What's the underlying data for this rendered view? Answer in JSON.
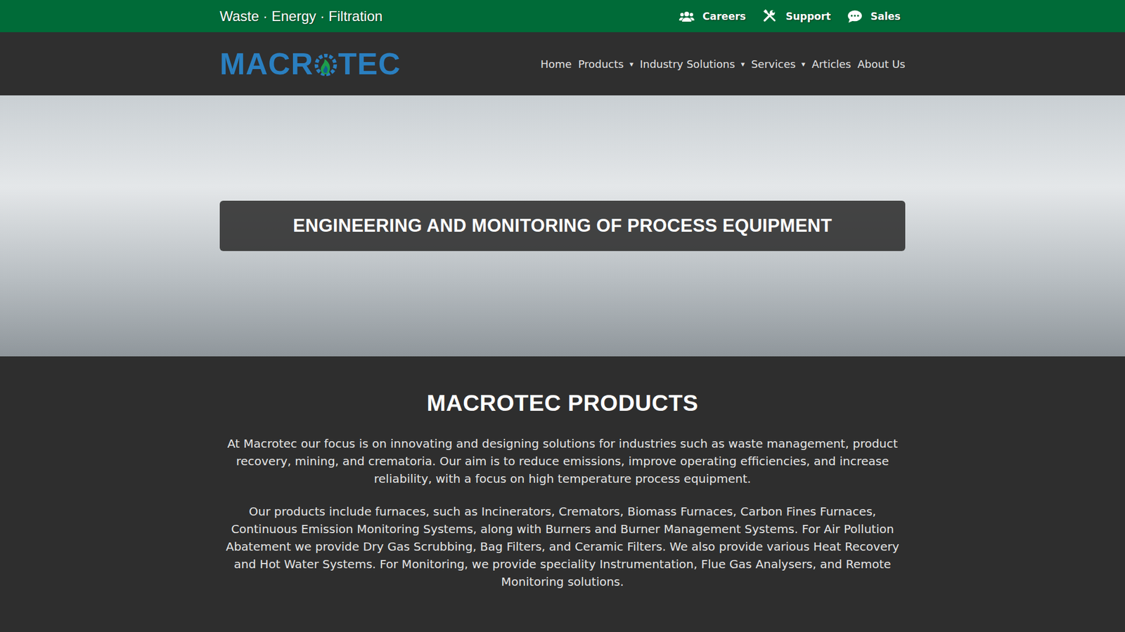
{
  "topbar": {
    "tagline": "Waste · Energy · Filtration",
    "links": [
      {
        "label": "Careers",
        "icon": "users"
      },
      {
        "label": "Support",
        "icon": "tools"
      },
      {
        "label": "Sales",
        "icon": "chat"
      }
    ]
  },
  "logo": {
    "before": "MACR",
    "after": "TEC"
  },
  "nav": [
    {
      "label": "Home",
      "dropdown": false
    },
    {
      "label": "Products",
      "dropdown": true
    },
    {
      "label": "Industry Solutions",
      "dropdown": true
    },
    {
      "label": "Services",
      "dropdown": true
    },
    {
      "label": "Articles",
      "dropdown": false
    },
    {
      "label": "About Us",
      "dropdown": false
    }
  ],
  "nav_caret": "▾",
  "hero": {
    "title": "ENGINEERING AND MONITORING OF PROCESS EQUIPMENT"
  },
  "section": {
    "heading": "MACROTEC PRODUCTS",
    "paragraphs": [
      "At Macrotec our focus is on innovating and designing solutions for industries such as waste management, product recovery, mining, and crematoria. Our aim is to reduce emissions, improve operating efficiencies, and increase reliability, with a focus on high temperature process equipment.",
      "Our products include furnaces, such as Incinerators, Cremators, Biomass Furnaces, Carbon Fines Furnaces, Continuous Emission Monitoring Systems, along with Burners and Burner Management Systems. For Air Pollution Abatement we provide Dry Gas Scrubbing, Bag Filters, and Ceramic Filters. We also provide various Heat Recovery and Hot Water Systems. For Monitoring, we provide speciality Instrumentation, Flue Gas Analysers, and Remote Monitoring solutions."
    ]
  }
}
